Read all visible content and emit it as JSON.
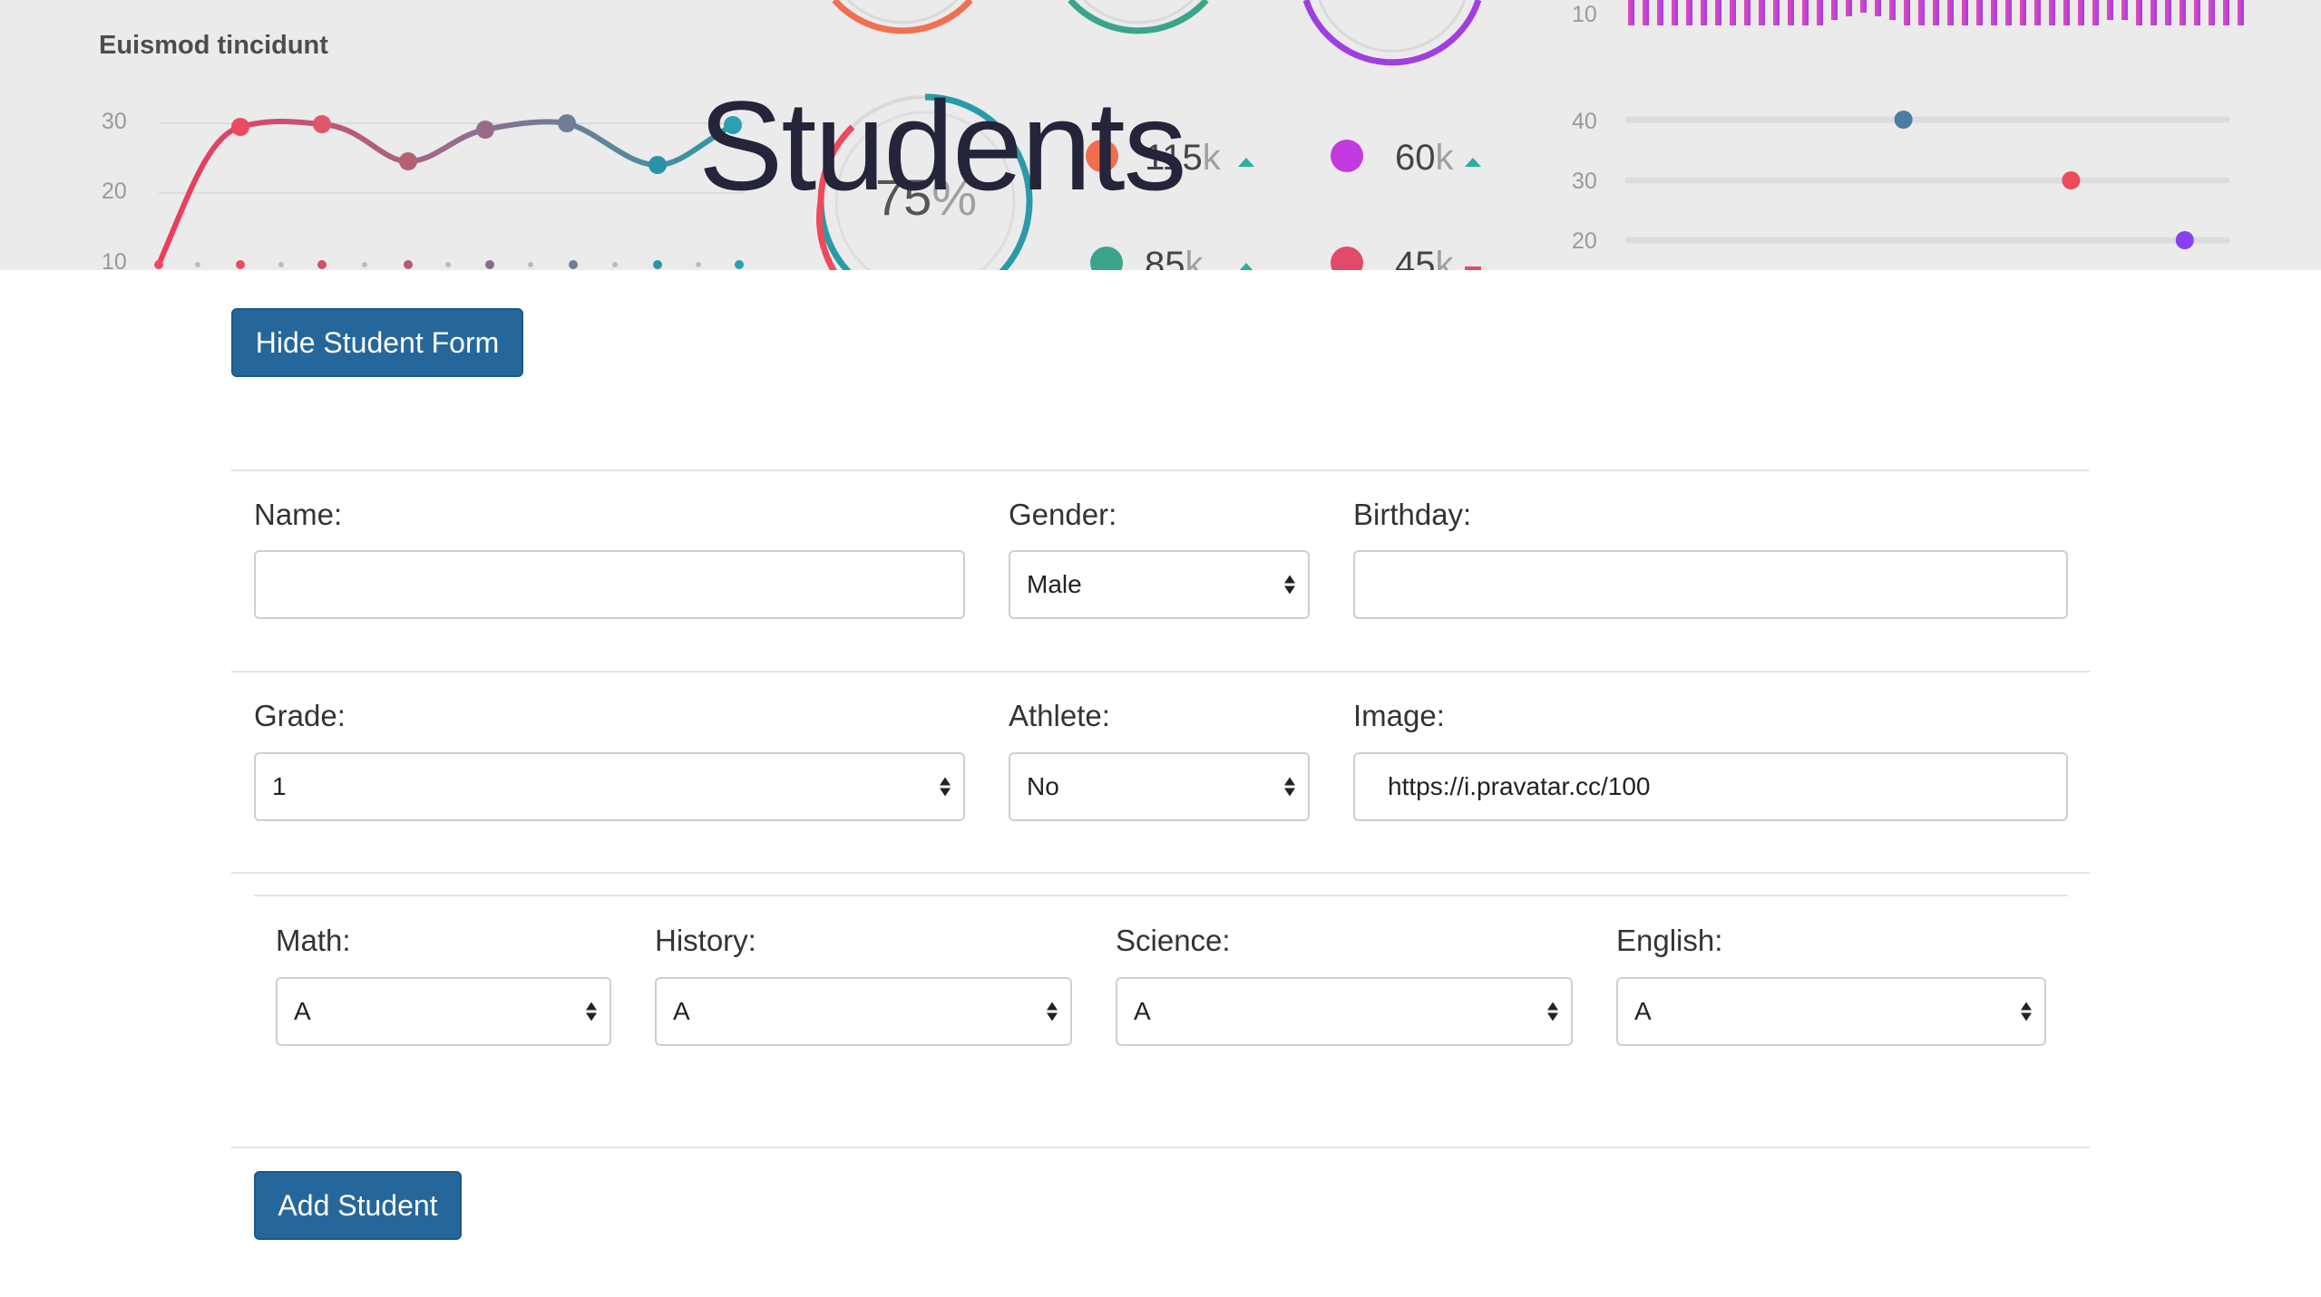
{
  "hero": {
    "chart_title": "Euismod tincidunt",
    "left_ticks": [
      "30",
      "20",
      "10"
    ],
    "right_ticks": [
      "10",
      "40",
      "30",
      "20"
    ],
    "gauge_percent": "75",
    "gauge_unit": "%",
    "stats": [
      {
        "value": "115",
        "unit": "k"
      },
      {
        "value": "60",
        "unit": "k"
      },
      {
        "value": "85",
        "unit": "k"
      },
      {
        "value": "45",
        "unit": "k"
      }
    ],
    "sliders": [
      {
        "level": 0.46,
        "color_start": "#3aa58a",
        "color_end": "#4a7ea0"
      },
      {
        "level": 0.74,
        "color_start": "#f6b26b",
        "color_end": "#ef4a5a"
      },
      {
        "level": 0.93,
        "color_start": "#e24aa8",
        "color_end": "#8a3ff0"
      }
    ],
    "line_values": [
      10,
      29,
      30,
      24,
      28,
      30,
      26,
      29
    ]
  },
  "page_title": "Students",
  "toggle_button": "Hide Student Form",
  "form": {
    "name_label": "Name:",
    "name_value": "",
    "gender_label": "Gender:",
    "gender_value": "Male",
    "birthday_label": "Birthday:",
    "birthday_value": "",
    "grade_label": "Grade:",
    "grade_value": "1",
    "athlete_label": "Athlete:",
    "athlete_value": "No",
    "image_label": "Image:",
    "image_value": "https://i.pravatar.cc/100",
    "math_label": "Math:",
    "math_value": "A",
    "history_label": "History:",
    "history_value": "A",
    "science_label": "Science:",
    "science_value": "A",
    "english_label": "English:",
    "english_value": "A"
  },
  "submit_button": "Add Student",
  "colors": {
    "button": "#26679b",
    "title": "#24243a",
    "hero_bg": "#ebebeb"
  }
}
